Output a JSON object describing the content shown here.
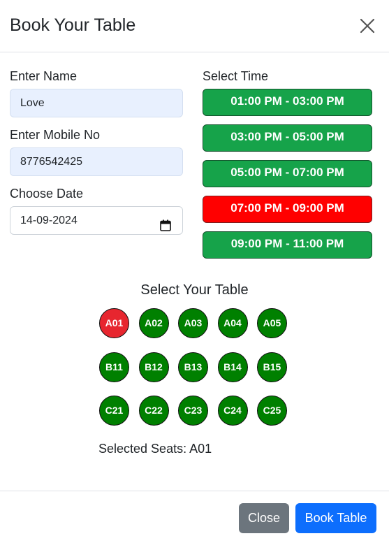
{
  "modal": {
    "title": "Book Your Table"
  },
  "form": {
    "name_label": "Enter Name",
    "name_value": "Love",
    "mobile_label": "Enter Mobile No",
    "mobile_value": "8776542425",
    "date_label": "Choose Date",
    "date_value": "14-09-2024"
  },
  "time": {
    "label": "Select Time",
    "slots": [
      {
        "label": "01:00 PM - 03:00 PM",
        "color": "#16a34a"
      },
      {
        "label": "03:00 PM - 05:00 PM",
        "color": "#16a34a"
      },
      {
        "label": "05:00 PM - 07:00 PM",
        "color": "#16a34a"
      },
      {
        "label": "07:00 PM - 09:00 PM",
        "color": "#ff0000"
      },
      {
        "label": "09:00 PM - 11:00 PM",
        "color": "#16a34a"
      }
    ]
  },
  "tables": {
    "title": "Select Your Table",
    "rows": [
      [
        "A01",
        "A02",
        "A03",
        "A04",
        "A05"
      ],
      [
        "B11",
        "B12",
        "B13",
        "B14",
        "B15"
      ],
      [
        "C21",
        "C22",
        "C23",
        "C24",
        "C25"
      ]
    ],
    "selected_text": "Selected Seats: A01",
    "colors": {
      "available": "#008000",
      "selected": "#e7262f"
    }
  },
  "footer": {
    "close_label": "Close",
    "book_label": "Book Table"
  }
}
